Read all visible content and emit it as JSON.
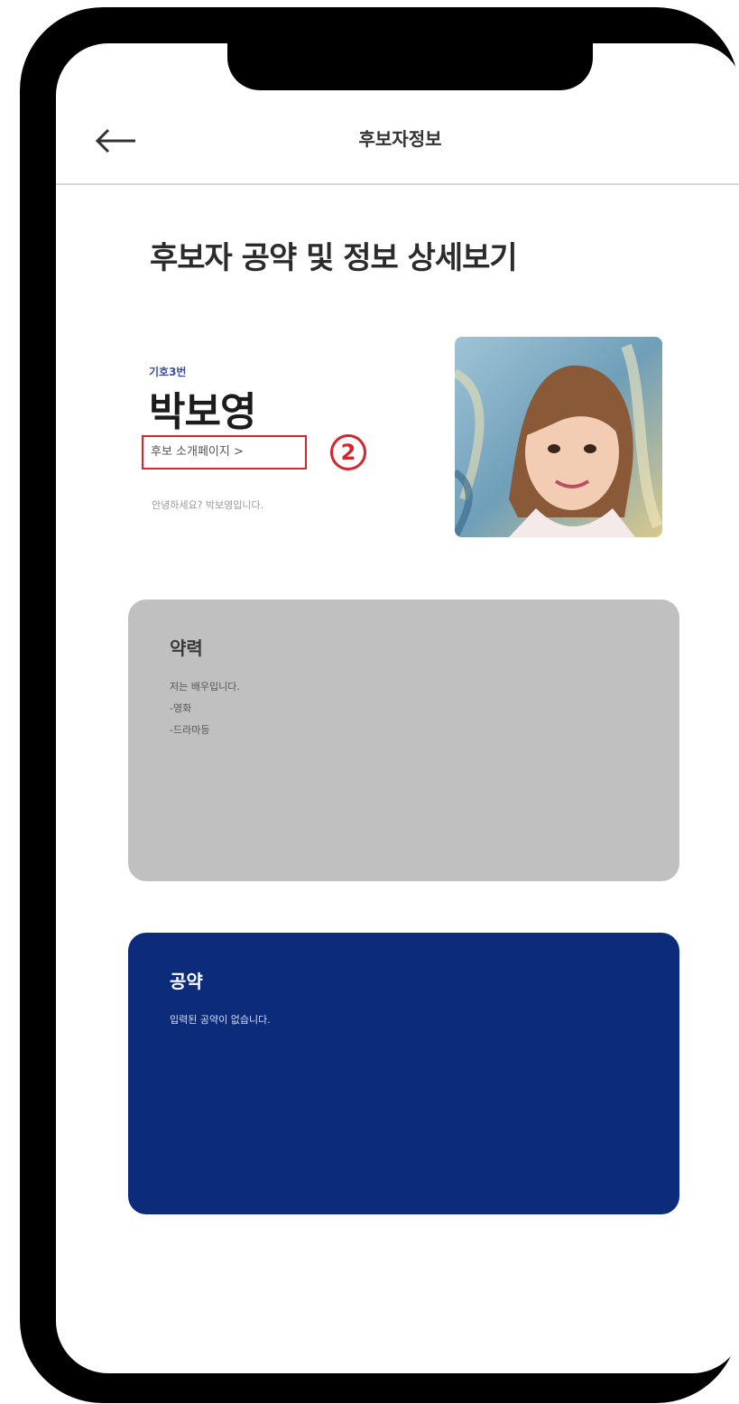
{
  "nav": {
    "title": "후보자정보",
    "back_icon": "arrow-left-icon"
  },
  "page": {
    "title": "후보자 공약 및 정보 상세보기"
  },
  "candidate": {
    "number": "기호3번",
    "name": "박보영",
    "promo_link": "후보 소개페이지 >",
    "step_marker": "2",
    "greeting": "안녕하세요? 박보영입니다.",
    "photo_icon": "candidate-photo"
  },
  "career": {
    "title": "약력",
    "lines": [
      "저는 배우입니다.",
      "-영화",
      "-드라마등"
    ]
  },
  "pledge": {
    "title": "공약",
    "lines": [
      "입력된 공약이 없습니다."
    ]
  },
  "colors": {
    "accent_red": "#d5262e",
    "pledge_bg": "#0c2b7a",
    "career_bg": "#c0c0c0",
    "badge_blue": "#3b4fa0"
  }
}
